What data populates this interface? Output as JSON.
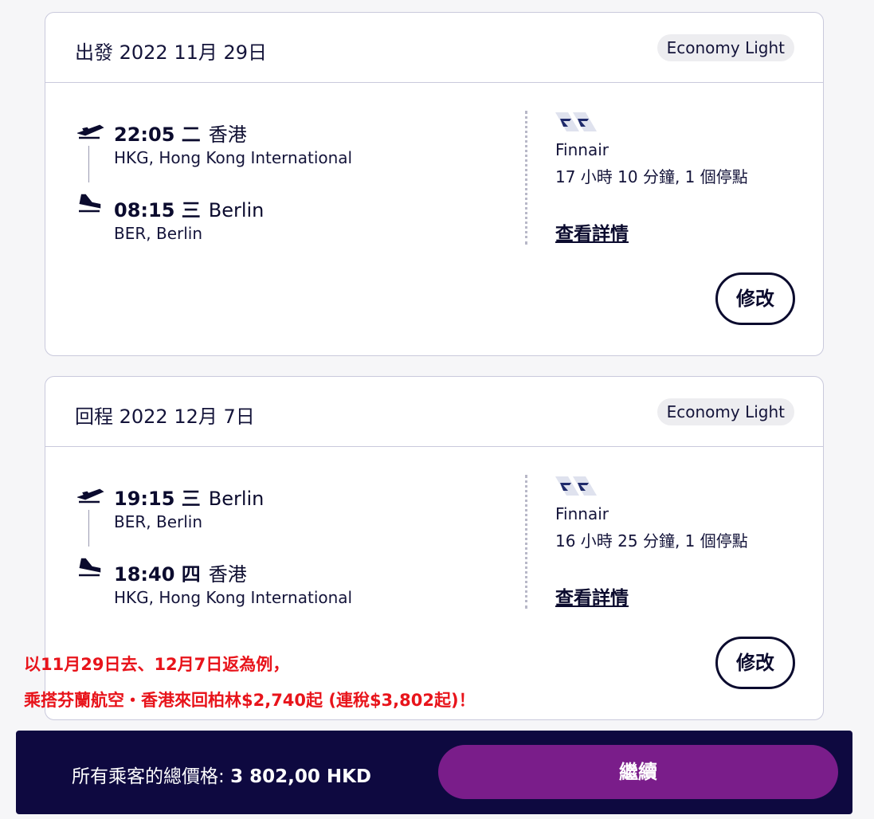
{
  "outbound": {
    "title": "出發 2022 11月 29日",
    "fare": "Economy Light",
    "depart_time": "22:05 二",
    "depart_place": "香港",
    "depart_airport": "HKG, Hong Kong International",
    "arrive_time": "08:15 三",
    "arrive_place": "Berlin",
    "arrive_airport": "BER, Berlin",
    "airline": "Finnair",
    "duration": "17 小時 10 分鐘, 1 個停點",
    "details_label": "查看詳情",
    "modify_label": "修改"
  },
  "return": {
    "title": "回程 2022 12月 7日",
    "fare": "Economy Light",
    "depart_time": "19:15 三",
    "depart_place": "Berlin",
    "depart_airport": "BER, Berlin",
    "arrive_time": "18:40 四",
    "arrive_place": "香港",
    "arrive_airport": "HKG, Hong Kong International",
    "airline": "Finnair",
    "duration": "16 小時 25 分鐘, 1 個停點",
    "details_label": "查看詳情",
    "modify_label": "修改"
  },
  "promo": {
    "line1": "以11月29日去、12月7日返為例，",
    "line2": "乘搭芬蘭航空・香港來回柏林$2,740起 (連稅$3,802起)！"
  },
  "footer": {
    "total_label": "所有乘客的總價格:",
    "total_amount": "3 802,00 HKD",
    "continue_label": "繼續"
  },
  "icons": {
    "takeoff": "plane-takeoff-icon",
    "landing": "plane-landing-icon",
    "airline_logo": "finnair-logo"
  },
  "colors": {
    "navy": "#0e0940",
    "purple": "#7a1d8a",
    "promo_red": "#e8141b"
  }
}
